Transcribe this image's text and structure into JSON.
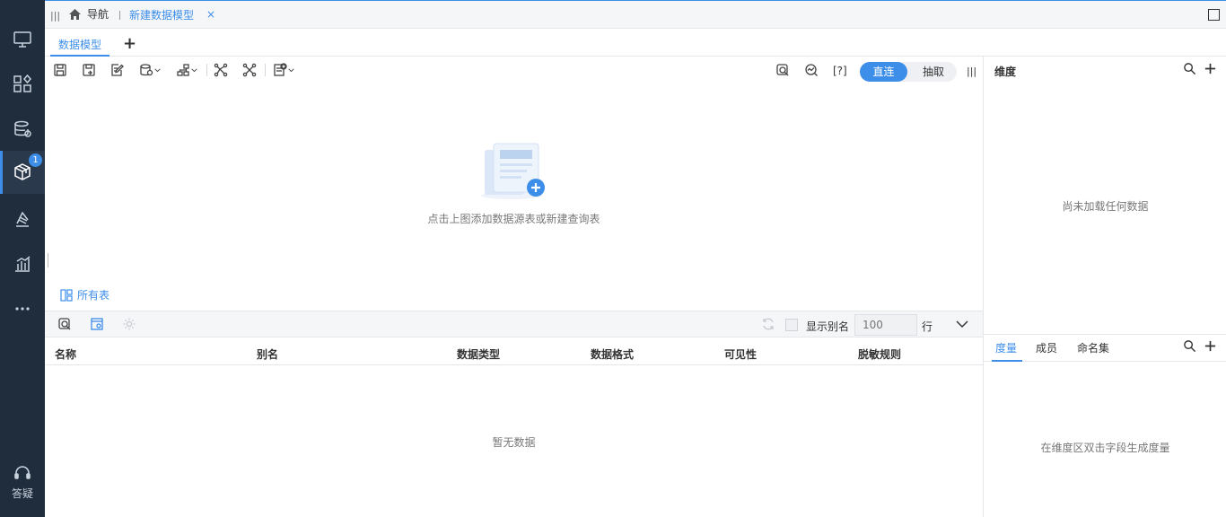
{
  "topbar": {
    "nav_label": "导航",
    "active_tab": "新建数据模型",
    "close_glyph": "×"
  },
  "model_tabs": {
    "active": "数据模型",
    "add_glyph": "+"
  },
  "sidebar": {
    "items": [
      {
        "icon": "monitor-icon"
      },
      {
        "icon": "dashboard-grid-icon"
      },
      {
        "icon": "database-settings-icon"
      },
      {
        "icon": "cube-model-icon",
        "badge": "1",
        "active": true
      },
      {
        "icon": "bookmark-stack-icon"
      },
      {
        "icon": "bar-chart-icon"
      },
      {
        "icon": "more-icon"
      }
    ],
    "help_label": "答疑"
  },
  "toolbar": {
    "help_text": "[?]",
    "mode_on": "直连",
    "mode_off": "抽取"
  },
  "canvas": {
    "empty_text": "点击上图添加数据源表或新建查询表"
  },
  "tables": {
    "all_tables_label": "所有表",
    "show_alias_label": "显示别名",
    "rows_placeholder": "100",
    "rows_unit": "行",
    "columns": [
      "名称",
      "别名",
      "数据类型",
      "数据格式",
      "可见性",
      "脱敏规则"
    ],
    "empty_text": "暂无数据"
  },
  "right_panel": {
    "dimension_title": "维度",
    "dimension_empty": "尚未加载任何数据",
    "tabs": [
      "度量",
      "成员",
      "命名集"
    ],
    "measure_empty": "在维度区双击字段生成度量"
  },
  "colors": {
    "accent": "#3d8ee8",
    "rail_bg": "#1f2d3d"
  }
}
